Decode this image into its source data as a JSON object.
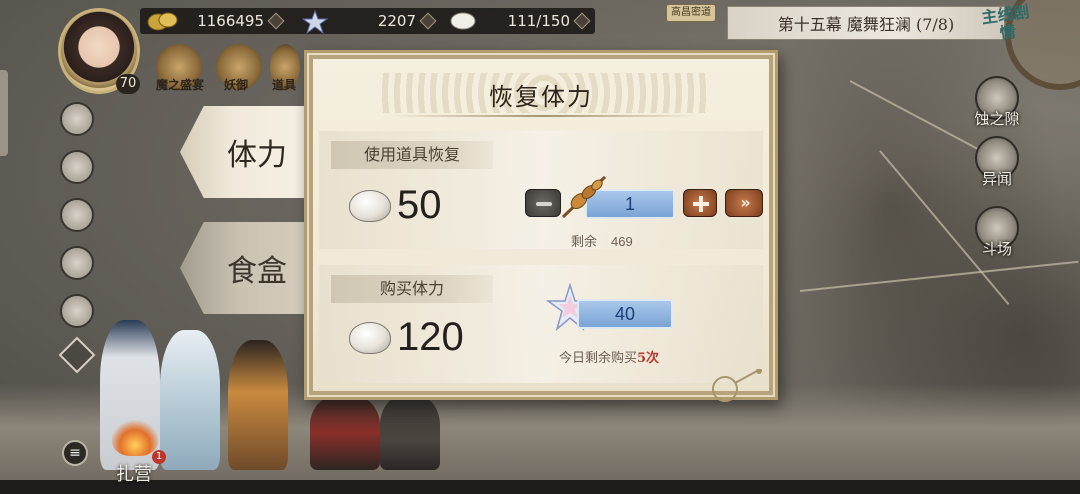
{
  "resources": {
    "coins": "1166495",
    "jade": "2207",
    "stamina": "111/150"
  },
  "player": {
    "level": "70"
  },
  "quick_icons": [
    {
      "label": "魔之盛宴"
    },
    {
      "label": "妖御"
    },
    {
      "label": "道具"
    }
  ],
  "chapter": {
    "tag": "高昌密道",
    "title": "第十五幕 魔舞狂澜 (7/8)",
    "main_story": "主线剧情"
  },
  "right_menu": [
    {
      "label": "蚀之隙"
    },
    {
      "label": "异闻"
    },
    {
      "label": "斗场"
    }
  ],
  "camp": {
    "label": "扎营",
    "badge": "1"
  },
  "tabs": [
    {
      "label": "体力",
      "active": true
    },
    {
      "label": "食盒",
      "active": false
    }
  ],
  "dialog": {
    "title": "恢复体力",
    "use_item": {
      "label": "使用道具恢复",
      "cost": "50",
      "quantity": "1",
      "remaining_label": "剩余",
      "remaining_value": "469",
      "max_symbol": "»"
    },
    "buy": {
      "label": "购买体力",
      "cost": "120",
      "quantity": "40",
      "daily_prefix": "今日剩余购买",
      "daily_count": "5次"
    }
  },
  "colors": {
    "panel_bg": "#f3ecdc",
    "panel_border": "#b39c6e",
    "qty_blue": "#7aa4d6",
    "orange_button": "#a35a30",
    "badge_red": "#c0352c"
  }
}
